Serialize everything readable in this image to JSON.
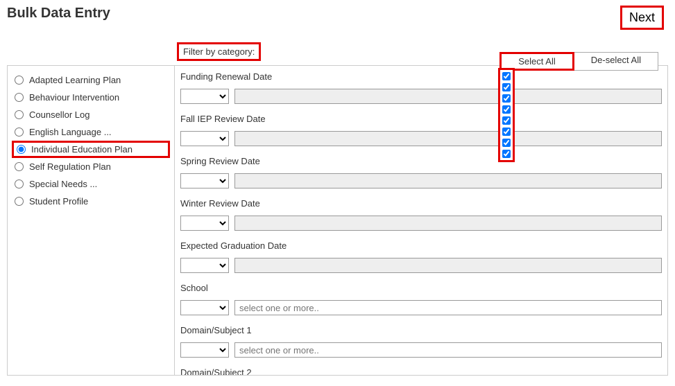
{
  "title": "Bulk Data Entry",
  "next_button": "Next",
  "filter_label": "Filter by category:",
  "select_all": "Select All",
  "deselect_all": "De-select All",
  "categories": [
    {
      "label": "Adapted Learning Plan",
      "selected": false
    },
    {
      "label": "Behaviour Intervention",
      "selected": false
    },
    {
      "label": "Counsellor Log",
      "selected": false
    },
    {
      "label": "English Language ...",
      "selected": false
    },
    {
      "label": "Individual Education Plan",
      "selected": true
    },
    {
      "label": "Self Regulation Plan",
      "selected": false
    },
    {
      "label": "Special Needs ...",
      "selected": false
    },
    {
      "label": "Student Profile",
      "selected": false
    }
  ],
  "fields": [
    {
      "label": "Funding Renewal Date",
      "type": "date",
      "value": "",
      "placeholder": ""
    },
    {
      "label": "Fall IEP Review Date",
      "type": "date",
      "value": "",
      "placeholder": ""
    },
    {
      "label": "Spring Review Date",
      "type": "date",
      "value": "",
      "placeholder": ""
    },
    {
      "label": "Winter Review Date",
      "type": "date",
      "value": "",
      "placeholder": ""
    },
    {
      "label": "Expected Graduation Date",
      "type": "date",
      "value": "",
      "placeholder": ""
    },
    {
      "label": "School",
      "type": "multi",
      "value": "",
      "placeholder": "select one or more.."
    },
    {
      "label": "Domain/Subject 1",
      "type": "multi",
      "value": "",
      "placeholder": "select one or more.."
    },
    {
      "label": "Domain/Subject 2",
      "type": "multi",
      "value": "",
      "placeholder": ""
    }
  ],
  "check_count": 8
}
